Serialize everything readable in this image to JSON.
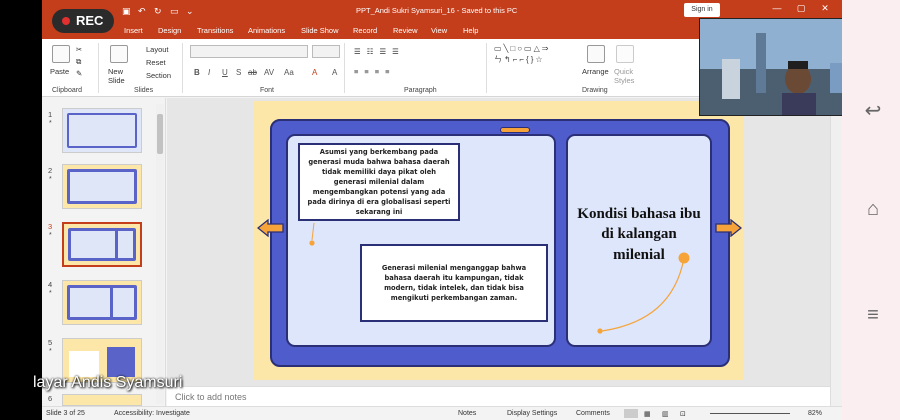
{
  "recording": {
    "label": "REC"
  },
  "titlebar": {
    "doc_title": "PPT_Andi Sukri  Syamsuri_16 - Saved to this PC",
    "signin_label": "Sign in"
  },
  "tabs": [
    "Insert",
    "Design",
    "Transitions",
    "Animations",
    "Slide Show",
    "Record",
    "Review",
    "View",
    "Help"
  ],
  "ribbon": {
    "clipboard": {
      "paste": "Paste",
      "group": "Clipboard"
    },
    "slides": {
      "new_slide": "New Slide",
      "layout": "Layout",
      "reset": "Reset",
      "section": "Section",
      "group": "Slides"
    },
    "font": {
      "group": "Font",
      "format_buttons": [
        "B",
        "I",
        "U",
        "S",
        "ab",
        "AV",
        "Aa",
        "A",
        "A"
      ]
    },
    "paragraph": {
      "group": "Paragraph"
    },
    "drawing": {
      "arrange": "Arrange",
      "quick_styles": "Quick Styles",
      "group": "Drawing"
    }
  },
  "thumbnails": [
    {
      "number": "1",
      "star": "*"
    },
    {
      "number": "2",
      "star": "*"
    },
    {
      "number": "3",
      "star": "*",
      "selected": true
    },
    {
      "number": "4",
      "star": "*"
    },
    {
      "number": "5",
      "star": "*"
    },
    {
      "number": "6",
      "star": ""
    }
  ],
  "slide": {
    "textbox1": "Asumsi yang berkembang pada generasi muda bahwa bahasa daerah tidak memiliki daya pikat oleh generasi milenial dalam mengembangkan potensi yang  ada pada dirinya di era globalisasi seperti sekarang ini",
    "textbox2": "Generasi milenial menganggap bahwa bahasa daerah itu kampungan, tidak modern, tidak intelek, dan tidak bisa mengikuti perkembangan zaman.",
    "title": "Kondisi bahasa ibu di kalangan milenial"
  },
  "notes": {
    "placeholder": "Click to add notes"
  },
  "status": {
    "slide_count": "Slide 3 of 25",
    "accessibility": "Accessibility: Investigate",
    "notes_btn": "Notes",
    "display_settings": "Display Settings",
    "comments": "Comments",
    "zoom": "82%"
  },
  "overlay": {
    "caption": "layar Andis Syamsuri"
  },
  "colors": {
    "accent": "#c43e1c",
    "slide_bg": "#fde7a8",
    "device_blue": "#4f5ccc",
    "panel_bg": "#dde6fa",
    "orange": "#f6a43a"
  }
}
